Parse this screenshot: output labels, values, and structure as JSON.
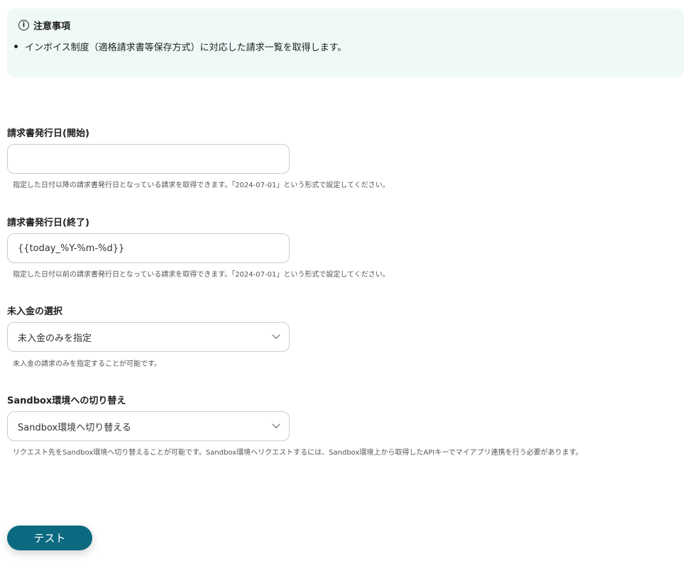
{
  "notice": {
    "title": "注意事項",
    "items": [
      "インボイス制度（適格請求書等保存方式）に対応した請求一覧を取得します。"
    ]
  },
  "fields": [
    {
      "label": "請求書発行日(開始)",
      "value": "",
      "help": "指定した日付以降の請求書発行日となっている請求を取得できます。「2024-07-01」という形式で設定してください。"
    },
    {
      "label": "請求書発行日(終了)",
      "value": "{{today_%Y-%m-%d}}",
      "help": "指定した日付以前の請求書発行日となっている請求を取得できます。「2024-07-01」という形式で設定してください。"
    },
    {
      "label": "未入金の選択",
      "value": "未入金のみを指定",
      "help": "未入金の請求のみを指定することが可能です。"
    },
    {
      "label": "Sandbox環境への切り替え",
      "value": "Sandbox環境へ切り替える",
      "help": "リクエスト先をSandbox環境へ切り替えることが可能です。Sandbox環境へリクエストするには、Sandbox環境上から取得したAPIキーでマイアプリ連携を行う必要があります。"
    }
  ],
  "test_button": "テスト",
  "colors": {
    "accent": "#0c6a80",
    "notice_bg": "#eff9f8"
  }
}
